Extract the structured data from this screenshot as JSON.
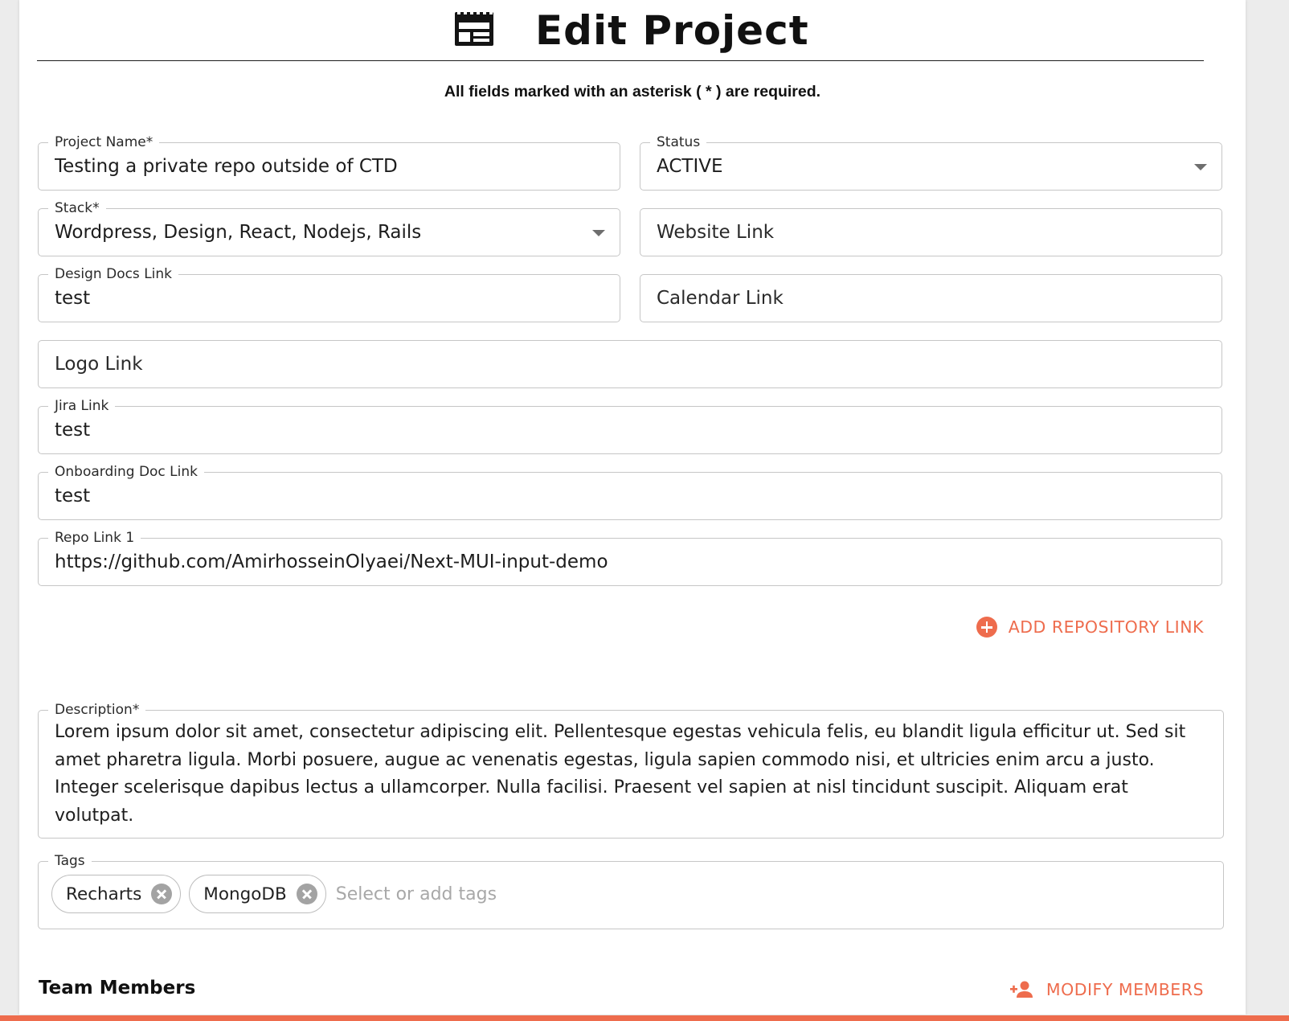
{
  "page": {
    "title": "Edit Project",
    "required_note": "All fields marked with an asterisk ( * ) are required."
  },
  "form": {
    "project_name": {
      "label": "Project Name*",
      "value": "Testing a private repo outside of CTD"
    },
    "status": {
      "label": "Status",
      "value": "ACTIVE"
    },
    "stack": {
      "label": "Stack*",
      "value": "Wordpress, Design, React, Nodejs, Rails"
    },
    "website_link": {
      "placeholder": "Website Link",
      "value": ""
    },
    "design_docs_link": {
      "label": "Design Docs Link",
      "value": "test"
    },
    "calendar_link": {
      "placeholder": "Calendar Link",
      "value": ""
    },
    "logo_link": {
      "placeholder": "Logo Link",
      "value": ""
    },
    "jira_link": {
      "label": "Jira Link",
      "value": "test"
    },
    "onboarding_doc_link": {
      "label": "Onboarding Doc Link",
      "value": "test"
    },
    "repo_link_1": {
      "label": "Repo Link 1",
      "value": "https://github.com/AmirhosseinOlyaei/Next-MUI-input-demo"
    },
    "add_repo_label": "ADD REPOSITORY LINK",
    "description": {
      "label": "Description*",
      "value": "Lorem ipsum dolor sit amet, consectetur adipiscing elit. Pellentesque egestas vehicula felis, eu blandit ligula efficitur ut. Sed sit amet pharetra ligula. Morbi posuere, augue ac venenatis egestas, ligula sapien commodo nisi, et ultricies enim arcu a justo. Integer scelerisque dapibus lectus a ullamcorper. Nulla facilisi. Praesent vel sapien at nisl tincidunt suscipit. Aliquam erat volutpat."
    },
    "tags": {
      "label": "Tags",
      "items": [
        "Recharts",
        "MongoDB"
      ],
      "placeholder": "Select or add tags"
    }
  },
  "team": {
    "title": "Team Members",
    "modify_label": "MODIFY MEMBERS"
  },
  "icons": {
    "header": "table-layout-icon",
    "add_repo": "add-circle-icon",
    "tag_remove": "cancel-circle-icon",
    "modify_members": "person-add-icon",
    "select": "arrow-drop-down-icon"
  },
  "colors": {
    "accent": "#ee6c4d",
    "border": "#c6c6c6",
    "text": "#1c1c1c"
  }
}
